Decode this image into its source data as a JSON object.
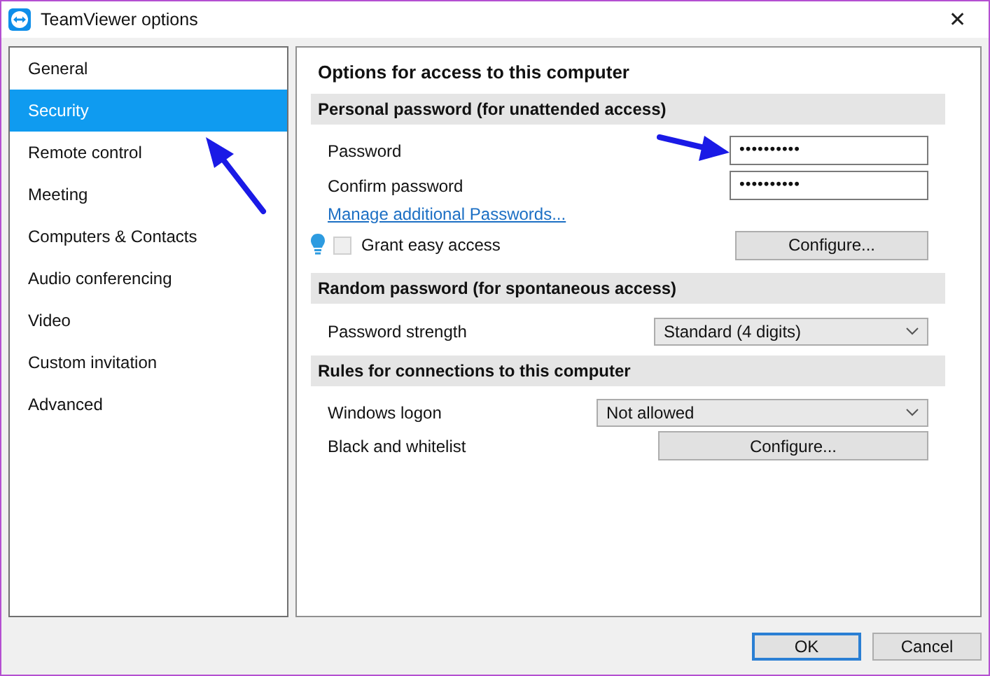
{
  "window": {
    "title": "TeamViewer options",
    "close": "✕"
  },
  "sidebar": {
    "items": [
      {
        "label": "General",
        "selected": false
      },
      {
        "label": "Security",
        "selected": true
      },
      {
        "label": "Remote control",
        "selected": false
      },
      {
        "label": "Meeting",
        "selected": false
      },
      {
        "label": "Computers & Contacts",
        "selected": false
      },
      {
        "label": "Audio conferencing",
        "selected": false
      },
      {
        "label": "Video",
        "selected": false
      },
      {
        "label": "Custom invitation",
        "selected": false
      },
      {
        "label": "Advanced",
        "selected": false
      }
    ]
  },
  "main": {
    "title": "Options for access to this computer",
    "sections": [
      {
        "header": "Personal password (for unattended access)",
        "rows": [
          {
            "kind": "password",
            "label": "Password",
            "value": "••••••••••"
          },
          {
            "kind": "password",
            "label": "Confirm password",
            "value": "••••••••••"
          },
          {
            "kind": "link",
            "label": "Manage additional Passwords..."
          },
          {
            "kind": "checkbox",
            "label": "Grant easy access",
            "checked": false,
            "disabled": true,
            "button": "Configure..."
          }
        ]
      },
      {
        "header": "Random password (for spontaneous access)",
        "rows": [
          {
            "kind": "select",
            "label": "Password strength",
            "value": "Standard (4 digits)"
          }
        ]
      },
      {
        "header": "Rules for connections to this computer",
        "rows": [
          {
            "kind": "select",
            "label": "Windows logon",
            "value": "Not allowed"
          },
          {
            "kind": "button",
            "label": "Black and whitelist",
            "button": "Configure..."
          }
        ]
      }
    ]
  },
  "buttons": [
    {
      "label": "OK",
      "default": true
    },
    {
      "label": "Cancel",
      "default": false
    }
  ]
}
